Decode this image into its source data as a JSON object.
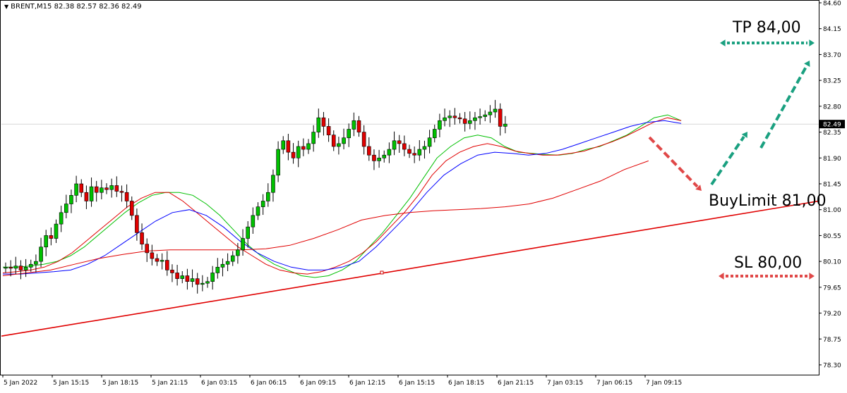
{
  "header": {
    "symbol": "BRENT,M15",
    "ohlc": "82.38 82.57 82.36 82.49"
  },
  "chart_data": {
    "type": "candlestick",
    "ylim": [
      78.0,
      84.6
    ],
    "y_ticks": [
      "84.60",
      "84.15",
      "83.70",
      "83.25",
      "82.80",
      "82.35",
      "81.90",
      "81.45",
      "81.00",
      "80.55",
      "80.10",
      "79.65",
      "79.20",
      "78.75",
      "78.30"
    ],
    "x_ticks": [
      "5 Jan 2022",
      "5 Jan 15:15",
      "5 Jan 18:15",
      "5 Jan 21:15",
      "6 Jan 03:15",
      "6 Jan 06:15",
      "6 Jan 09:15",
      "6 Jan 12:15",
      "6 Jan 15:15",
      "6 Jan 18:15",
      "6 Jan 21:15",
      "7 Jan 03:15",
      "7 Jan 06:15",
      "7 Jan 09:15"
    ],
    "current_price": "82.49",
    "close_series": [
      80.0,
      79.98,
      80.02,
      79.95,
      80.0,
      80.05,
      80.1,
      80.35,
      80.55,
      80.5,
      80.75,
      80.95,
      81.1,
      81.25,
      81.45,
      81.3,
      81.15,
      81.4,
      81.3,
      81.38,
      81.35,
      81.42,
      81.32,
      81.3,
      81.15,
      80.9,
      80.6,
      80.4,
      80.25,
      80.15,
      80.1,
      80.12,
      79.95,
      79.9,
      79.8,
      79.85,
      79.75,
      79.8,
      79.7,
      79.72,
      79.75,
      79.9,
      80.0,
      80.05,
      80.1,
      80.2,
      80.3,
      80.5,
      80.7,
      80.9,
      81.05,
      81.15,
      81.3,
      81.6,
      82.05,
      82.2,
      82.0,
      81.9,
      82.1,
      82.05,
      82.15,
      82.35,
      82.6,
      82.45,
      82.3,
      82.1,
      82.15,
      82.25,
      82.4,
      82.55,
      82.35,
      82.1,
      81.95,
      81.85,
      81.9,
      81.95,
      82.05,
      82.2,
      82.15,
      82.05,
      81.98,
      81.95,
      82.05,
      82.1,
      82.25,
      82.4,
      82.55,
      82.6,
      82.63,
      82.6,
      82.58,
      82.5,
      82.55,
      82.6,
      82.62,
      82.65,
      82.7,
      82.75,
      82.45,
      82.49
    ],
    "series": [
      {
        "name": "",
        "color": "#00c000",
        "values": [
          80.0,
          80.0,
          80.02,
          80.05,
          80.1,
          80.2,
          80.35,
          80.55,
          80.75,
          80.95,
          81.12,
          81.25,
          81.3,
          81.3,
          81.25,
          81.1,
          80.9,
          80.65,
          80.4,
          80.2,
          80.05,
          79.95,
          79.85,
          79.82,
          79.85,
          79.95,
          80.1,
          80.35,
          80.6,
          80.9,
          81.2,
          81.55,
          81.9,
          82.1,
          82.25,
          82.3,
          82.25,
          82.1,
          82.0,
          81.98,
          81.96,
          81.95,
          81.98,
          82.05,
          82.1,
          82.2,
          82.3,
          82.45,
          82.6,
          82.65,
          82.55
        ]
      },
      {
        "name": "",
        "color": "#e00000",
        "values": [
          79.9,
          79.92,
          79.95,
          80.0,
          80.1,
          80.25,
          80.45,
          80.65,
          80.85,
          81.05,
          81.2,
          81.3,
          81.3,
          81.15,
          80.95,
          80.75,
          80.55,
          80.35,
          80.2,
          80.05,
          79.95,
          79.9,
          79.88,
          79.92,
          80.0,
          80.1,
          80.25,
          80.45,
          80.7,
          80.95,
          81.25,
          81.6,
          81.85,
          82.0,
          82.1,
          82.15,
          82.1,
          82.02,
          81.98,
          81.95,
          81.95,
          81.98,
          82.02,
          82.1,
          82.18,
          82.28,
          82.4,
          82.52,
          82.6,
          82.55
        ]
      },
      {
        "name": "",
        "color": "#0000ff",
        "values": [
          79.88,
          79.88,
          79.9,
          79.92,
          79.95,
          80.05,
          80.2,
          80.4,
          80.6,
          80.8,
          80.95,
          81.0,
          80.9,
          80.7,
          80.45,
          80.25,
          80.1,
          80.0,
          79.95,
          79.95,
          80.0,
          80.1,
          80.35,
          80.65,
          80.95,
          81.3,
          81.6,
          81.8,
          81.95,
          82.0,
          81.98,
          81.95,
          81.98,
          82.05,
          82.15,
          82.25,
          82.35,
          82.45,
          82.52,
          82.55,
          82.5
        ]
      },
      {
        "name": "",
        "color": "#e00000",
        "values": [
          79.85,
          79.9,
          79.95,
          80.05,
          80.15,
          80.22,
          80.28,
          80.3,
          80.3,
          80.3,
          80.3,
          80.32,
          80.38,
          80.5,
          80.65,
          80.82,
          80.9,
          80.95,
          80.98,
          81.0,
          81.02,
          81.05,
          81.1,
          81.2,
          81.35,
          81.5,
          81.7,
          81.85
        ]
      }
    ],
    "trendline": {
      "from": [
        0,
        78.8
      ],
      "to": [
        1,
        81.15
      ],
      "color": "#e00000"
    },
    "annotations": {
      "tp": "TP 84,00",
      "buy": "BuyLimit 81,00",
      "sl": "SL 80,00"
    },
    "colors": {
      "up": "#00c000",
      "down": "#e00000",
      "grid": "#c0c0c0",
      "tp_arrow": "#1aa080",
      "sl_arrow": "#e04848"
    }
  }
}
